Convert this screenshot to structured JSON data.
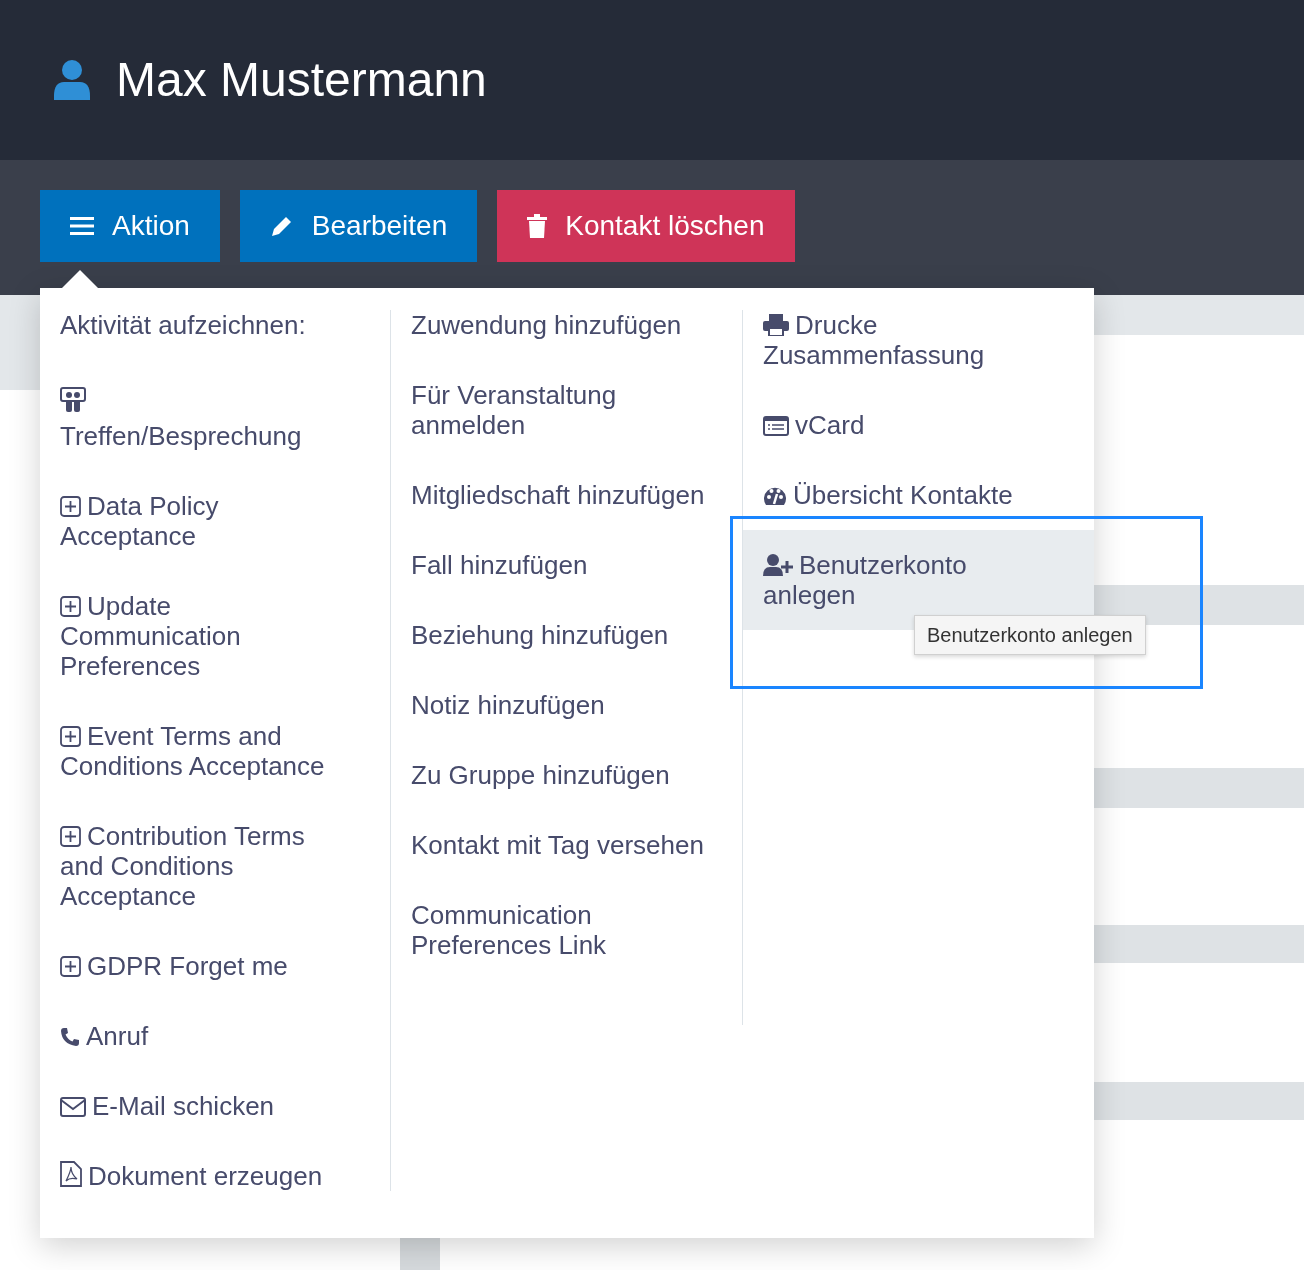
{
  "header": {
    "title": "Max Mustermann"
  },
  "toolbar": {
    "buttons": [
      {
        "label": "Aktion",
        "kind": "menu",
        "expanded": true
      },
      {
        "label": "Bearbeiten",
        "kind": "edit",
        "expanded": false
      },
      {
        "label": "Kontakt löschen",
        "kind": "delete",
        "expanded": false
      }
    ]
  },
  "menu": {
    "columns": [
      {
        "heading": "Aktivität aufzeichnen:",
        "items": [
          {
            "label": "Treffen/Besprechung",
            "kind": "meeting",
            "selected": false
          },
          {
            "label": "Data Policy Acceptance",
            "kind": "form",
            "selected": false
          },
          {
            "label": "Update Communication Preferences",
            "kind": "form",
            "selected": false
          },
          {
            "label": "Event Terms and Conditions Acceptance",
            "kind": "form",
            "selected": false
          },
          {
            "label": "Contribution Terms and Conditions Acceptance",
            "kind": "form",
            "selected": false
          },
          {
            "label": "GDPR Forget me",
            "kind": "form",
            "selected": false
          },
          {
            "label": "Anruf",
            "kind": "phone",
            "selected": false
          },
          {
            "label": "E-Mail schicken",
            "kind": "email",
            "selected": false
          },
          {
            "label": "Dokument erzeugen",
            "kind": "document",
            "selected": false
          }
        ]
      },
      {
        "items": [
          {
            "label": "Zuwendung hinzufügen",
            "kind": "plain",
            "selected": false
          },
          {
            "label": "Für Veranstaltung anmelden",
            "kind": "plain",
            "selected": false
          },
          {
            "label": "Mitgliedschaft hinzufügen",
            "kind": "plain",
            "selected": false
          },
          {
            "label": "Fall hinzufügen",
            "kind": "plain",
            "selected": false
          },
          {
            "label": "Beziehung hinzufügen",
            "kind": "plain",
            "selected": false
          },
          {
            "label": "Notiz hinzufügen",
            "kind": "plain",
            "selected": false
          },
          {
            "label": "Zu Gruppe hinzufügen",
            "kind": "plain",
            "selected": false
          },
          {
            "label": "Kontakt mit Tag versehen",
            "kind": "plain",
            "selected": false
          },
          {
            "label": "Communication Preferences Link",
            "kind": "plain",
            "selected": false
          }
        ]
      },
      {
        "items": [
          {
            "label": "Drucke Zusammenfassung",
            "kind": "print",
            "selected": false
          },
          {
            "label": "vCard",
            "kind": "vcard",
            "selected": false
          },
          {
            "label": "Übersicht Kontakte",
            "kind": "dashboard",
            "selected": false
          },
          {
            "label": "Benutzerkonto anlegen",
            "kind": "user-add",
            "selected": true,
            "tooltip": "Benutzerkonto anlegen"
          }
        ]
      }
    ]
  }
}
